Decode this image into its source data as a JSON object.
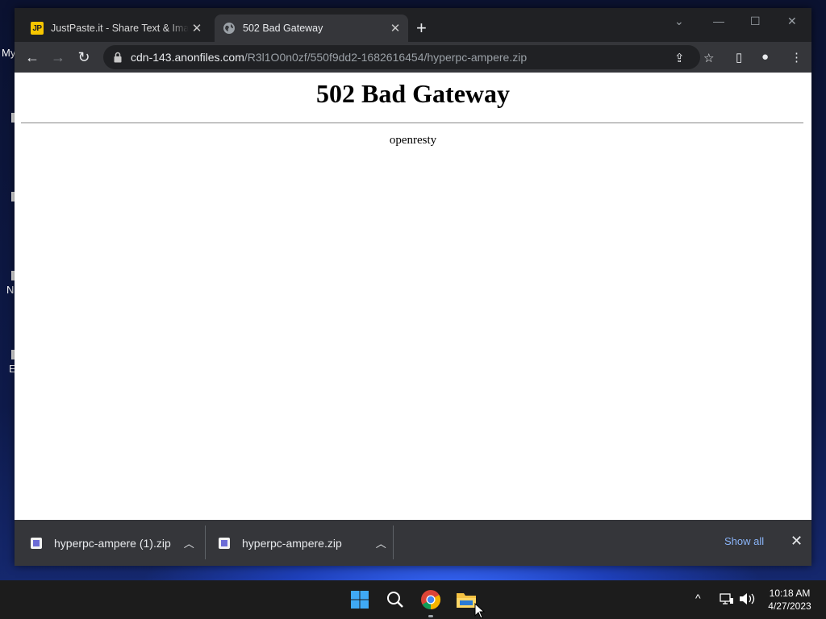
{
  "desktop": {
    "labels": [
      "My",
      "N",
      "E"
    ]
  },
  "browser": {
    "tabs": [
      {
        "title": "JustPaste.it - Share Text & Images",
        "favicon_text": "JP",
        "close": "✕"
      },
      {
        "title": "502 Bad Gateway",
        "close": "✕"
      }
    ],
    "new_tab": "+",
    "window_controls": {
      "dropdown": "⌄",
      "minimize": "—",
      "maximize": "☐",
      "close": "✕"
    },
    "toolbar": {
      "back": "←",
      "forward": "→",
      "reload": "↻",
      "url_host": "cdn-143.anonfiles.com",
      "url_path": "/R3l1O0n0zf/550f9dd2-1682616454/hyperpc-ampere.zip",
      "share": "⇪",
      "bookmark": "☆",
      "sidebar": "▯",
      "profile": "●",
      "menu": "⋮"
    }
  },
  "page": {
    "heading": "502 Bad Gateway",
    "server": "openresty"
  },
  "downloads": {
    "items": [
      {
        "filename": "hyperpc-ampere (1).zip",
        "chevron": "︿"
      },
      {
        "filename": "hyperpc-ampere.zip",
        "chevron": "︿"
      }
    ],
    "show_all": "Show all",
    "close": "✕"
  },
  "taskbar": {
    "tray_chevron": "^",
    "time": "10:18 AM",
    "date": "4/27/2023"
  },
  "colors": {
    "tab_active": "#35363a",
    "tabstrip": "#202124",
    "link": "#8ab4f8",
    "taskbar": "#1c1c1c"
  }
}
